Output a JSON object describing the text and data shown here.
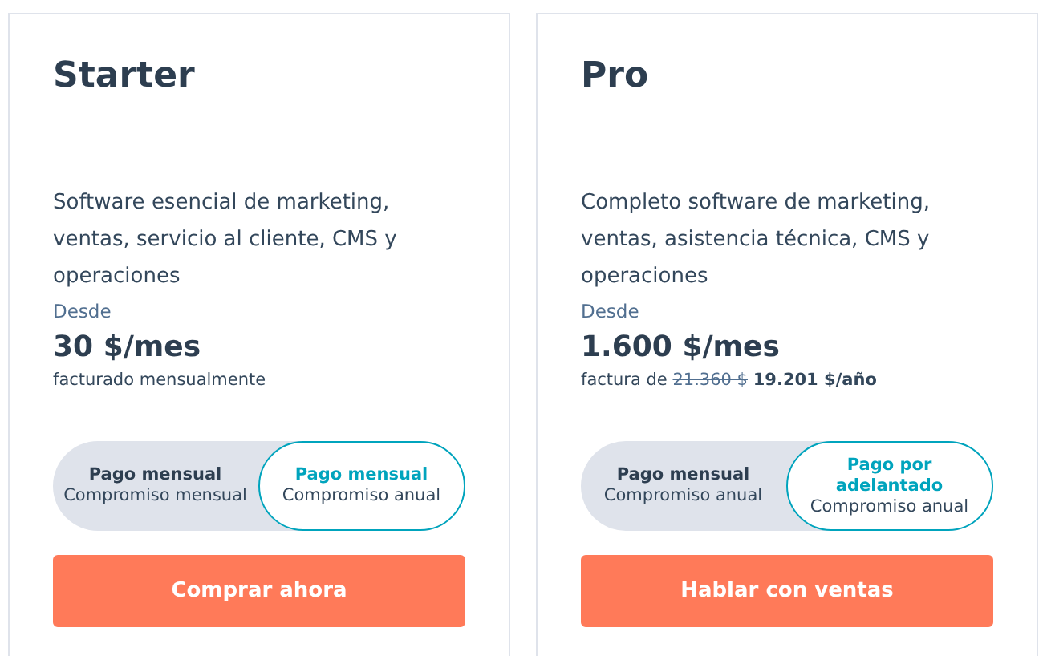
{
  "plans": [
    {
      "name": "Starter",
      "description": "Software esencial de marketing, ventas, servicio al cliente, CMS y operaciones",
      "from_label": "Desde",
      "price": "30 $/mes",
      "billing": "facturado mensualmente",
      "options": [
        {
          "title": "Pago mensual",
          "subtitle": "Compromiso mensual",
          "selected": false
        },
        {
          "title": "Pago mensual",
          "subtitle": "Compromiso anual",
          "selected": true
        }
      ],
      "cta": "Comprar ahora"
    },
    {
      "name": "Pro",
      "description": "Completo software de marketing, ventas, asistencia técnica, CMS y operaciones",
      "from_label": "Desde",
      "price": "1.600 $/mes",
      "billing": "factura de",
      "billing_old_price": "21.360 $",
      "billing_new_price": "19.201 $/año",
      "options": [
        {
          "title": "Pago mensual",
          "subtitle": "Compromiso anual",
          "selected": false
        },
        {
          "title": "Pago por adelantado",
          "subtitle": "Compromiso anual",
          "selected": true
        }
      ],
      "cta": "Hablar con ventas"
    }
  ]
}
